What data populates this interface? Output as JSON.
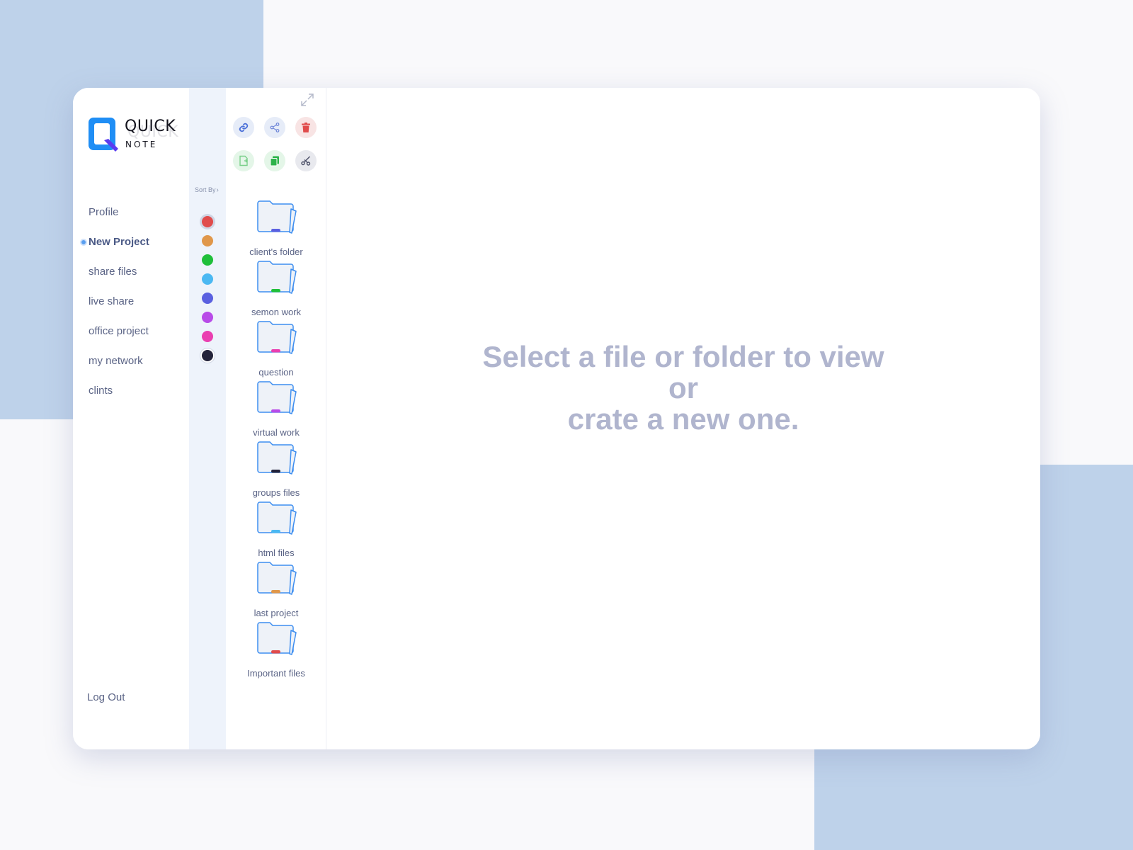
{
  "app": {
    "logo_title": "QUICK",
    "logo_subtitle": "NOTE",
    "brand_colors": {
      "primary": "#1f8ef5",
      "accent": "#5a3cf0"
    }
  },
  "sidebar": {
    "items": [
      {
        "label": "Profile",
        "active": false
      },
      {
        "label": "New Project",
        "active": true
      },
      {
        "label": "share files",
        "active": false
      },
      {
        "label": "live share",
        "active": false
      },
      {
        "label": "office project",
        "active": false
      },
      {
        "label": "my network",
        "active": false
      },
      {
        "label": "clints",
        "active": false
      }
    ],
    "logout_label": "Log Out"
  },
  "color_rail": {
    "sort_label": "Sort By",
    "swatches": [
      {
        "color": "#e04b4b",
        "selected": true
      },
      {
        "color": "#e0974a",
        "selected": false
      },
      {
        "color": "#1fbf3a",
        "selected": false
      },
      {
        "color": "#4bb8f2",
        "selected": false
      },
      {
        "color": "#5a60e0",
        "selected": false
      },
      {
        "color": "#b84be8",
        "selected": false
      },
      {
        "color": "#ea3fb0",
        "selected": false
      },
      {
        "color": "#23233a",
        "selected": false
      }
    ]
  },
  "toolbar": {
    "tools": [
      {
        "icon": "link-icon",
        "bg": "#e6ecf8",
        "color": "#4a6fd8"
      },
      {
        "icon": "share-icon",
        "bg": "#e6ecf8",
        "color": "#6f86d8"
      },
      {
        "icon": "trash-icon",
        "bg": "#f8e4e4",
        "color": "#e04b4b"
      },
      {
        "icon": "new-file-icon",
        "bg": "#e4f6e8",
        "color": "#7ad08a"
      },
      {
        "icon": "copy-icon",
        "bg": "#e4f6e8",
        "color": "#2db34a"
      },
      {
        "icon": "scissors-icon",
        "bg": "#e8e9ee",
        "color": "#4a4e66"
      }
    ]
  },
  "folders": [
    {
      "name": "client's folder",
      "tag_color": "#5a60e0"
    },
    {
      "name": "semon work",
      "tag_color": "#1fbf3a"
    },
    {
      "name": "question",
      "tag_color": "#ea3fb0"
    },
    {
      "name": "virtual work",
      "tag_color": "#b84be8"
    },
    {
      "name": "groups files",
      "tag_color": "#23233a"
    },
    {
      "name": "html files",
      "tag_color": "#4bb8f2"
    },
    {
      "name": "last project",
      "tag_color": "#e0974a"
    },
    {
      "name": "Important files",
      "tag_color": "#e04b4b"
    }
  ],
  "main": {
    "empty_line1": "Select a file or folder to view",
    "empty_line2": "or",
    "empty_line3": "crate a new one."
  }
}
